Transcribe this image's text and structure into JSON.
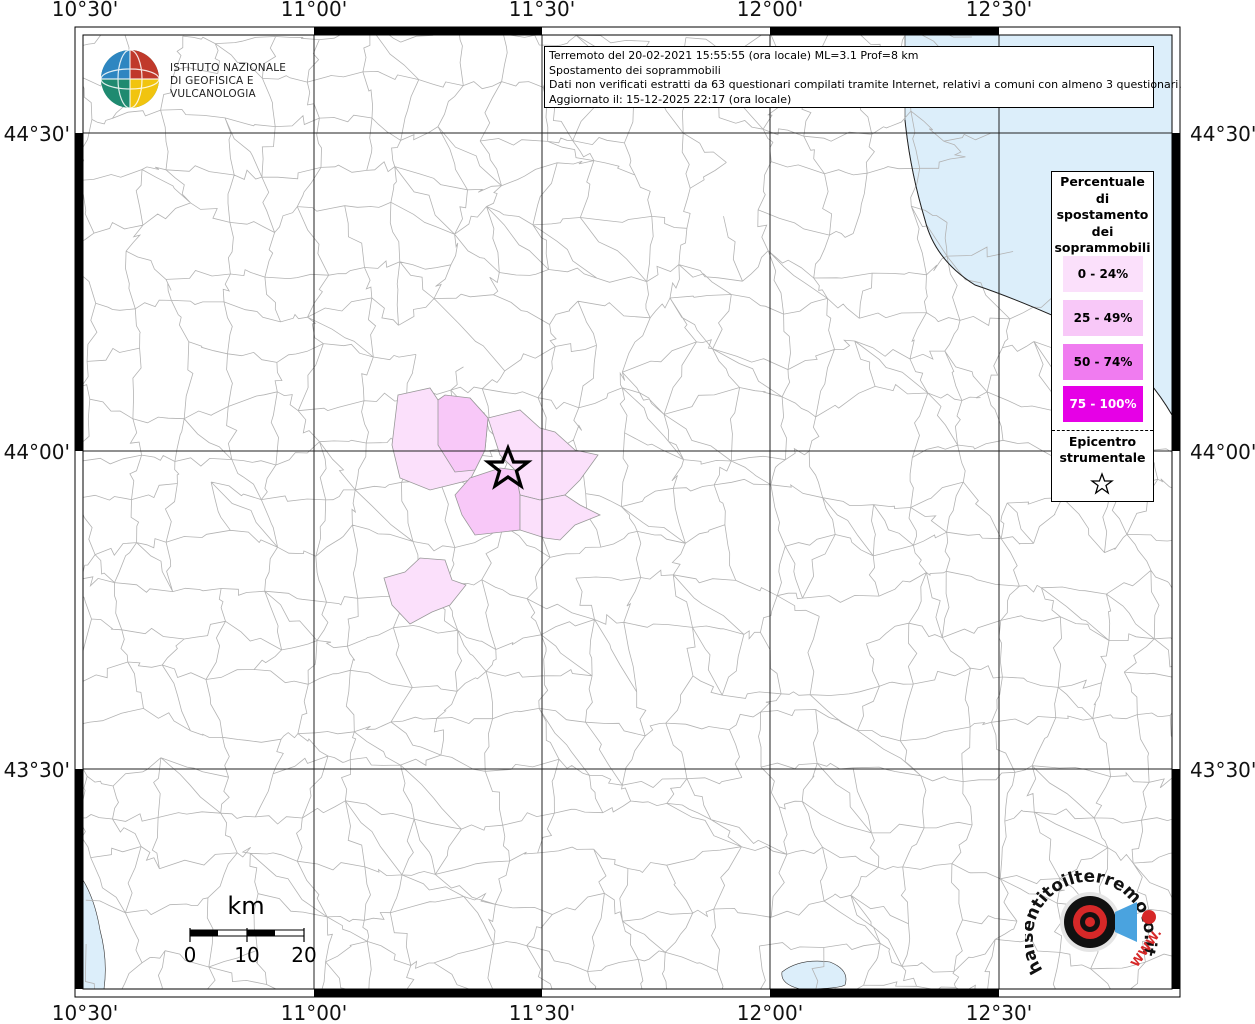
{
  "map": {
    "longitude_labels": [
      "10°30'",
      "11°00'",
      "11°30'",
      "12°00'",
      "12°30'"
    ],
    "latitude_labels": [
      "44°30'",
      "44°00'",
      "43°30'"
    ],
    "colors": {
      "sea": "#dceefa",
      "border_line": "#b3b3b3",
      "class_0_24": "#fbe0fb",
      "class_25_49": "#f8c8f8",
      "class_50_74": "#f07cf0",
      "class_75_100": "#e600e6"
    },
    "epicenter_icon": "star-icon"
  },
  "info": {
    "line1": "Terremoto del 20-02-2021 15:55:55 (ora locale) ML=3.1 Prof=8 km",
    "line2": "Spostamento dei soprammobili",
    "line3": "Dati non verificati estratti da 63 questionari compilati tramite Internet, relativi a comuni con almeno 3 questionari.",
    "line4": "Aggiornato il: 15-12-2025 22:17 (ora locale)"
  },
  "logo": {
    "line1": "ISTITUTO NAZIONALE",
    "line2": "DI GEOFISICA E VULCANOLOGIA"
  },
  "legend": {
    "title_lines": [
      "Percentuale",
      "di",
      "spostamento",
      "dei",
      "soprammobili"
    ],
    "classes": [
      "0 - 24%",
      "25 - 49%",
      "50 - 74%",
      "75 - 100%"
    ],
    "epicenter_lines": [
      "Epicentro",
      "strumentale"
    ]
  },
  "scale_bar": {
    "unit": "km",
    "ticks": [
      "0",
      "10",
      "20"
    ]
  },
  "hst_logo": {
    "text": "haisentitoilterremoto.it",
    "www": "WWW."
  }
}
